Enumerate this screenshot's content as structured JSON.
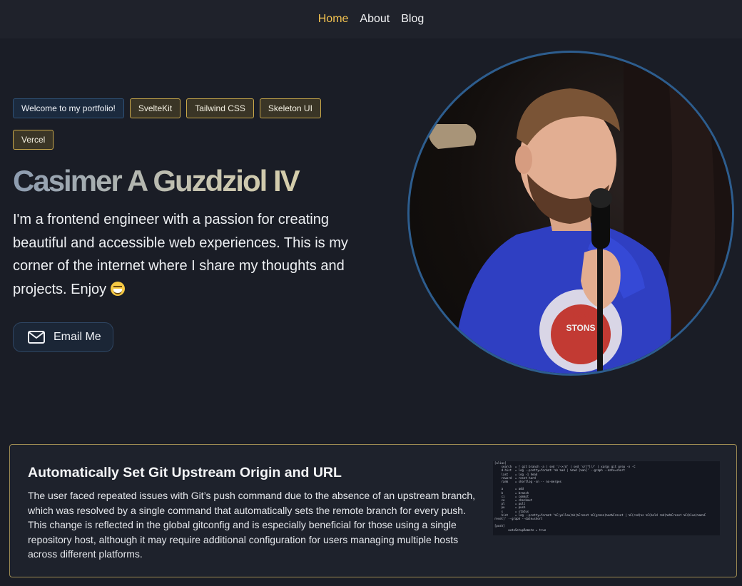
{
  "nav": {
    "items": [
      {
        "label": "Home",
        "active": true
      },
      {
        "label": "About",
        "active": false
      },
      {
        "label": "Blog",
        "active": false
      }
    ]
  },
  "hero": {
    "badges": [
      "Welcome to my portfolio!",
      "SvelteKit",
      "Tailwind CSS",
      "Skeleton UI",
      "Vercel"
    ],
    "name": "Casimer A Guzdziol IV",
    "bio": "I'm a frontend engineer with a passion for creating beautiful and accessible web experiences. This is my corner of the internet where I share my thoughts and projects. Enjoy",
    "emoji_icon": "grinning-face-emoji",
    "email_button": {
      "label": "Email Me",
      "icon": "mail-icon"
    }
  },
  "portrait": {
    "icon": "profile-photo"
  },
  "blog_card": {
    "title": "Automatically Set Git Upstream Origin and URL",
    "description": "The user faced repeated issues with Git’s push command due to the absence of an upstream branch, which was resolved by a single command that automatically sets the remote branch for every push. This change is reflected in the global gitconfig and is especially beneficial for those using a single repository host, although it may require additional configuration for users managing multiple hosts across different platforms.",
    "code_lines": [
      "[alias]",
      "    search  = ! git branch -a | sed '/->/d' | sed 's/[*]//' | xargs git grep -n -C",
      "    d-hist  = log --pretty=format:'%h %ad | %s%d [%an]' --graph --date=short",
      "    last    = log -1 head",
      "    reword  = reset hard",
      "    rank    = shortlog -sn -- no-merges",
      "",
      "    a       = add",
      "    b       = branch",
      "    ci      = commit",
      "    co      = checkout",
      "    pl      = pull",
      "    pu      = push",
      "    s       = status",
      "    hist    = log --pretty=format:'%C(yellow)%h|%Creset %C(green)%ad%Creset | %C(red)%s %C(bold red)%d%Creset %C(blue)%an%C",
      "reset]' --graph --date=short",
      "",
      "[push]",
      "        autoSetupRemote = true"
    ]
  },
  "colors": {
    "background": "#1a1d26",
    "nav_bg": "#1f222b",
    "accent": "#f5c451",
    "badge_border": "#c9a84a",
    "primary": "#2e5177",
    "portrait_ring": "#2d5d8e"
  }
}
